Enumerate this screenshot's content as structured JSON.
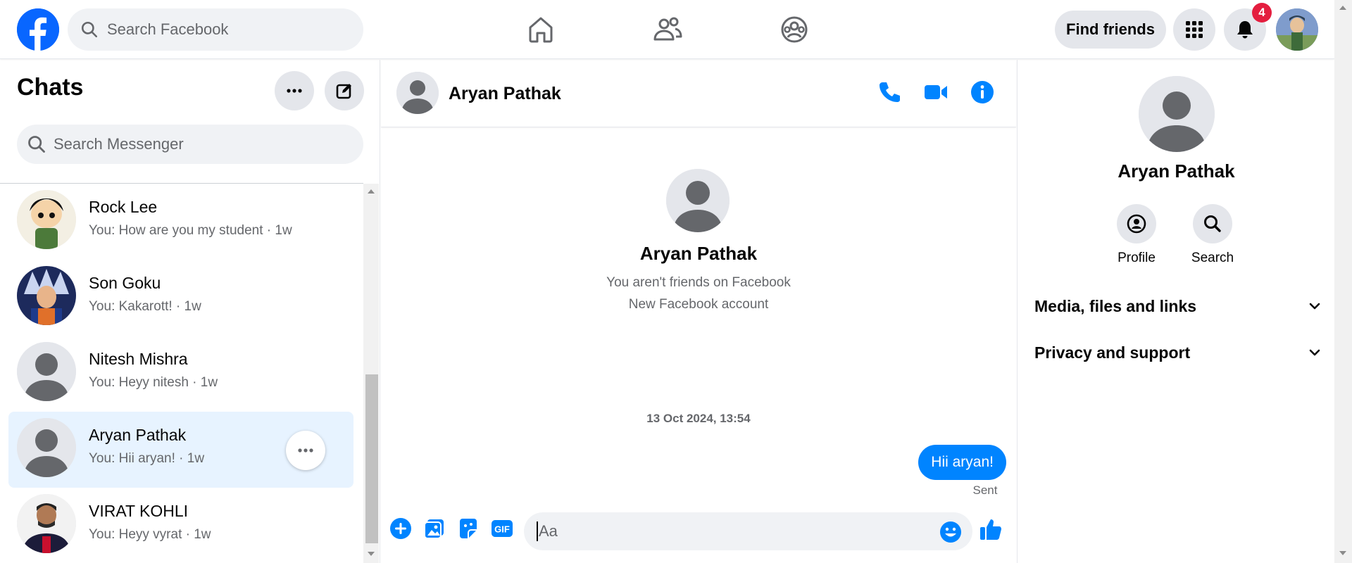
{
  "topbar": {
    "search_placeholder": "Search Facebook",
    "find_friends_label": "Find friends",
    "notification_count": "4",
    "brand_color": "#0866ff",
    "nav_icons": [
      "home-icon",
      "friends-icon",
      "groups-icon"
    ]
  },
  "chats": {
    "title": "Chats",
    "search_placeholder": "Search Messenger",
    "items": [
      {
        "name": "Rock Lee",
        "preview": "You: How are you my student · 1w"
      },
      {
        "name": "Son Goku",
        "preview": "You: Kakarott! · 1w"
      },
      {
        "name": "Nitesh Mishra",
        "preview": "You: Heyy nitesh · 1w"
      },
      {
        "name": "Aryan Pathak",
        "preview": "You: Hii aryan! · 1w",
        "active": true
      },
      {
        "name": "VIRAT KOHLI",
        "preview": "You: Heyy vyrat · 1w"
      }
    ]
  },
  "conversation": {
    "contact_name": "Aryan Pathak",
    "intro_name": "Aryan Pathak",
    "intro_line1": "You aren't friends on Facebook",
    "intro_line2": "New Facebook account",
    "timestamp": "13 Oct 2024, 13:54",
    "message": "Hii aryan!",
    "status": "Sent",
    "composer_placeholder": "Aa",
    "accent_color": "#0084ff"
  },
  "info_panel": {
    "name": "Aryan Pathak",
    "profile_label": "Profile",
    "search_label": "Search",
    "section1": "Media, files and links",
    "section2": "Privacy and support"
  }
}
